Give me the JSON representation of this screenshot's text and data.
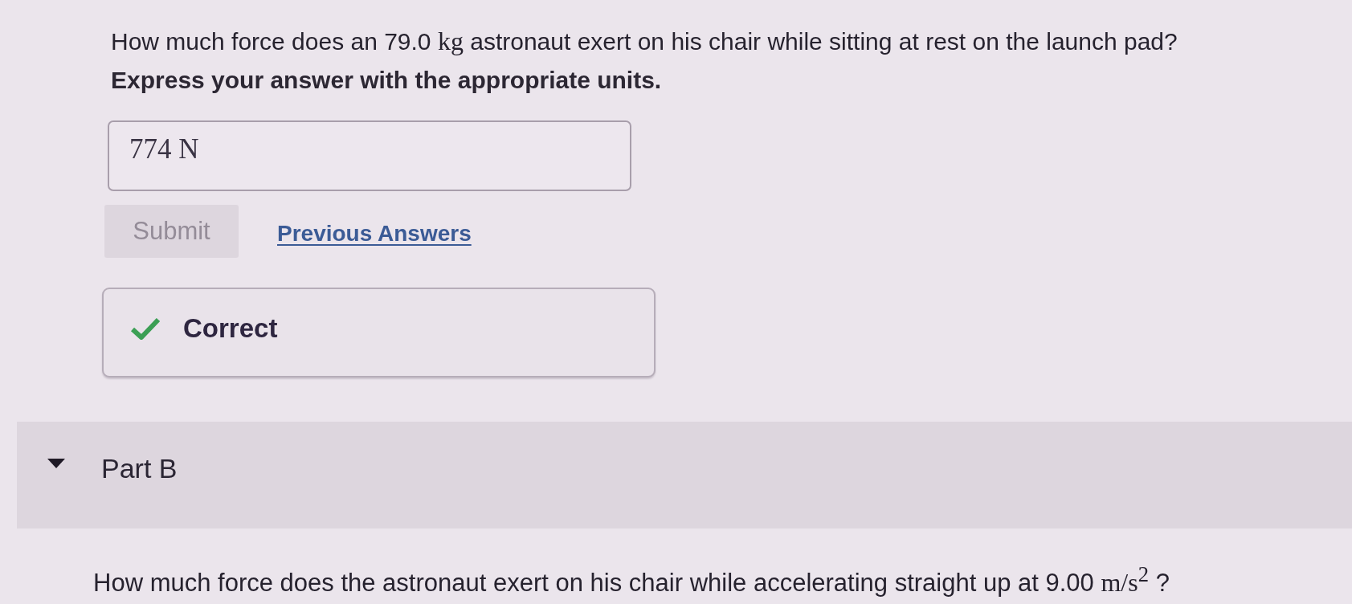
{
  "part_a": {
    "question": [
      {
        "kind": "text",
        "text": "How much force does an 79.0 "
      },
      {
        "kind": "math",
        "text": "kg"
      },
      {
        "kind": "text",
        "text": " astronaut exert on his chair while sitting at rest on the launch pad?"
      }
    ],
    "instruction": "Express your answer with the appropriate units.",
    "answer": {
      "value": "774 N"
    },
    "submit": {
      "label": "Submit",
      "disabled": true
    },
    "previous_answers": {
      "label": "Previous Answers"
    },
    "feedback": {
      "kind": "correct",
      "text": "Correct"
    }
  },
  "part_b": {
    "label": "Part B",
    "expanded": true,
    "question": [
      {
        "kind": "text",
        "text": "How much force does the astronaut exert on his chair while accelerating straight up at 9.00 "
      },
      {
        "kind": "math",
        "text": "m/s$^{2}$"
      },
      {
        "kind": "text",
        "text": " ?"
      }
    ]
  }
}
